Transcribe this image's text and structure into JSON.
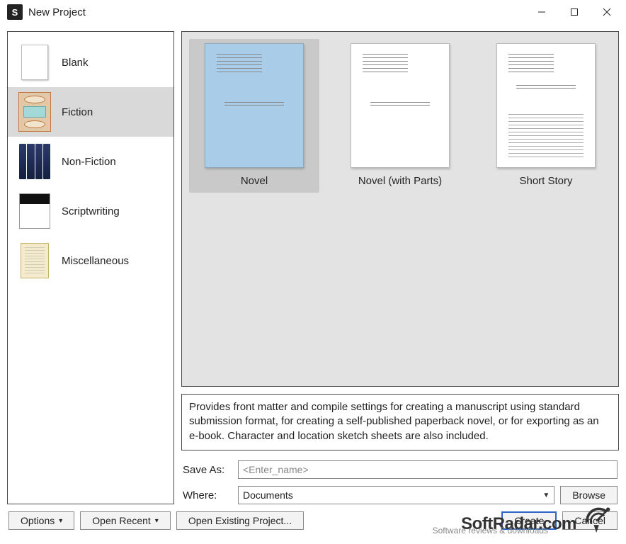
{
  "window": {
    "title": "New Project"
  },
  "categories": [
    {
      "label": "Blank",
      "icon": "blank"
    },
    {
      "label": "Fiction",
      "icon": "fiction",
      "selected": true
    },
    {
      "label": "Non-Fiction",
      "icon": "nonfiction"
    },
    {
      "label": "Scriptwriting",
      "icon": "scriptwriting"
    },
    {
      "label": "Miscellaneous",
      "icon": "misc"
    }
  ],
  "templates": [
    {
      "label": "Novel",
      "selected": true,
      "style": "title"
    },
    {
      "label": "Novel (with Parts)",
      "selected": false,
      "style": "title"
    },
    {
      "label": "Short Story",
      "selected": false,
      "style": "body"
    }
  ],
  "description": "Provides front matter and compile settings for creating a manuscript using standard submission format, for creating a self-published paperback novel, or for exporting as an e-book. Character and location sketch sheets are also included.",
  "form": {
    "save_as_label": "Save As:",
    "save_as_placeholder": "<Enter_name>",
    "save_as_value": "",
    "where_label": "Where:",
    "where_value": "Documents",
    "browse_label": "Browse"
  },
  "footer": {
    "options_label": "Options",
    "open_recent_label": "Open Recent",
    "open_existing_label": "Open Existing Project...",
    "create_label": "Create",
    "cancel_label": "Cancel"
  },
  "watermark": {
    "brand": "SoftRadar.com",
    "subtitle": "Software reviews & downloads"
  }
}
